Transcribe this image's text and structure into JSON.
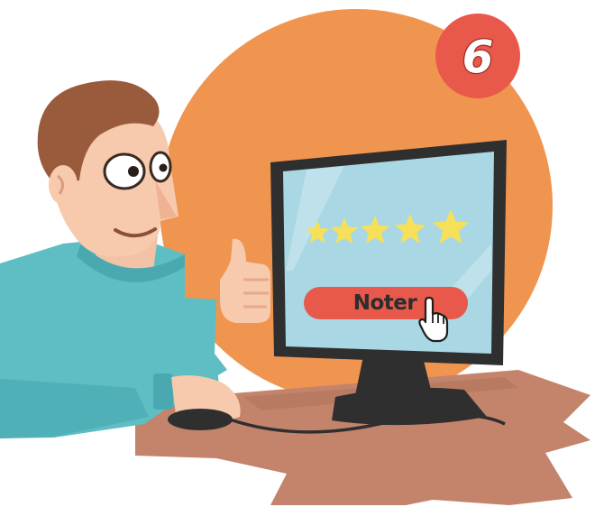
{
  "badge": {
    "number": "6"
  },
  "screen": {
    "rating": {
      "value": 5,
      "max": 5,
      "star_icon": "star-icon"
    },
    "rate_button": {
      "label": "Noter",
      "cursor_icon": "hand-pointer-icon"
    }
  },
  "colors": {
    "background_circle": "#f0954f",
    "badge": "#e8584b",
    "screen": "#a9d7e4",
    "star": "#f6e05a",
    "button": "#e8584b",
    "sweater": "#5ebec4",
    "desk": "#c4846c",
    "monitor": "#2f2f2f"
  }
}
